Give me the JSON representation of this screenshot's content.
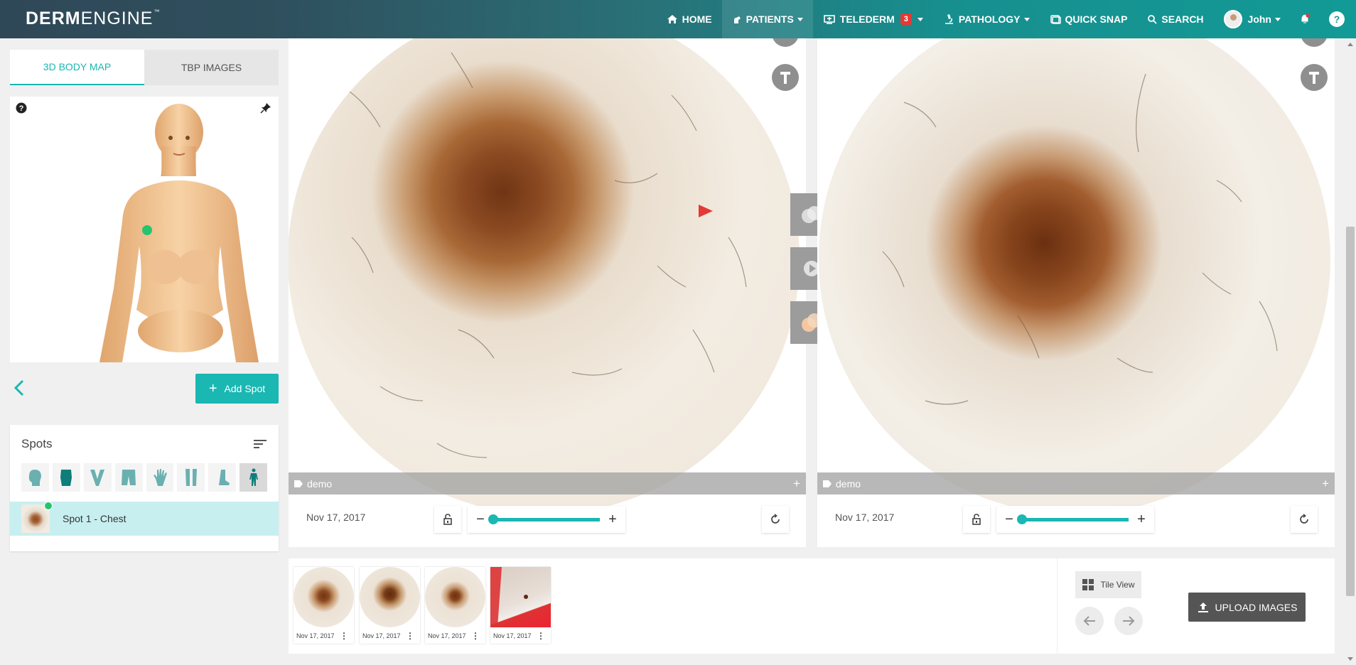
{
  "app": {
    "logo_bold": "DERM",
    "logo_light": "ENGINE",
    "logo_tm": "™"
  },
  "nav": {
    "home": "HOME",
    "patients": "PATIENTS",
    "telederm": "TELEDERM",
    "telederm_badge": "3",
    "pathology": "PATHOLOGY",
    "quick_snap": "QUICK SNAP",
    "search": "SEARCH",
    "user": "John",
    "help": "?"
  },
  "left": {
    "tabs": [
      {
        "label": "3D BODY MAP",
        "active": true
      },
      {
        "label": "TBP IMAGES",
        "active": false
      }
    ],
    "add_spot": "Add Spot",
    "spots_title": "Spots",
    "filters": [
      "head-icon",
      "torso-icon",
      "arms-icon",
      "legs-icon",
      "hand-icon",
      "lower-legs-icon",
      "foot-icon",
      "full-body-icon"
    ],
    "spot_item": "Spot 1 - Chest"
  },
  "viewers": [
    {
      "tag": "demo",
      "tag_plus": "+",
      "date": "Nov 17, 2017",
      "zoom_level": 0.0,
      "zoom_minus": "−",
      "zoom_plus": "+"
    },
    {
      "tag": "demo",
      "tag_plus": "+",
      "date": "Nov 17, 2017",
      "zoom_level": 0.0,
      "zoom_minus": "−",
      "zoom_plus": "+"
    }
  ],
  "strip": {
    "thumbs": [
      {
        "caption": "Nov 17, 2017",
        "dots": "⋮"
      },
      {
        "caption": "Nov 17, 2017",
        "dots": "⋮"
      },
      {
        "caption": "Nov 17, 2017",
        "dots": "⋮"
      },
      {
        "caption": "Nov 17, 2017",
        "dots": "⋮"
      }
    ],
    "tile_view": "Tile View",
    "upload": "UPLOAD IMAGES"
  },
  "colors": {
    "accent": "#1ab7b3",
    "topbar_start": "#2f4858",
    "topbar_end": "#129a96",
    "spot_selected": "#c8eff0",
    "spot_marker": "#27c46d"
  }
}
